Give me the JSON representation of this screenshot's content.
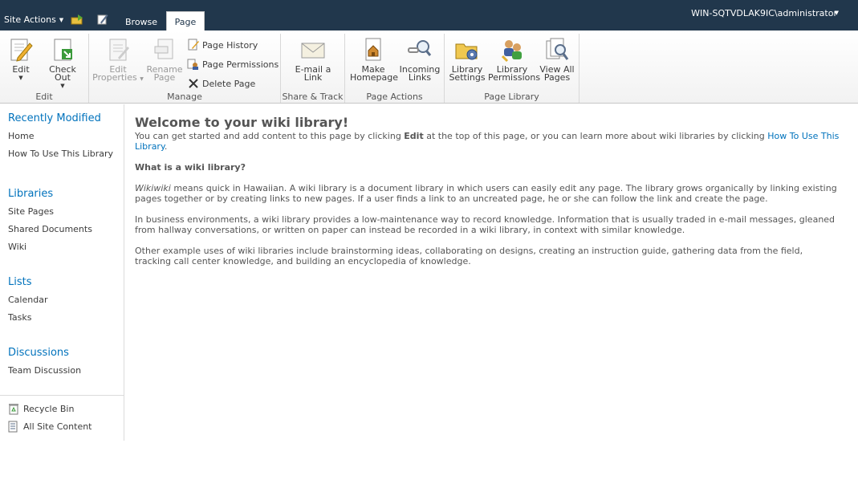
{
  "topbar": {
    "site_actions": "Site Actions",
    "tabs": [
      {
        "label": "Browse"
      },
      {
        "label": "Page"
      }
    ],
    "user": "WIN-SQTVDLAK9IC\\administrator"
  },
  "ribbon": {
    "groups": {
      "edit": {
        "label": "Edit",
        "edit_l1": "Edit",
        "checkout_l1": "Check Out"
      },
      "manage": {
        "label": "Manage",
        "props_l1": "Edit",
        "props_l2": "Properties",
        "rename_l1": "Rename",
        "rename_l2": "Page",
        "page_history": "Page History",
        "page_permissions": "Page Permissions",
        "delete_page": "Delete Page"
      },
      "share": {
        "label": "Share & Track",
        "email_l1": "E-mail a",
        "email_l2": "Link"
      },
      "page_actions": {
        "label": "Page Actions",
        "home_l1": "Make",
        "home_l2": "Homepage",
        "links_l1": "Incoming",
        "links_l2": "Links"
      },
      "library": {
        "label": "Page Library",
        "settings_l1": "Library",
        "settings_l2": "Settings",
        "perms_l1": "Library",
        "perms_l2": "Permissions",
        "viewall_l1": "View All",
        "viewall_l2": "Pages"
      }
    }
  },
  "leftnav": {
    "recently_modified": "Recently Modified",
    "recent_items": [
      "Home",
      "How To Use This Library"
    ],
    "libraries": "Libraries",
    "library_items": [
      "Site Pages",
      "Shared Documents",
      "Wiki"
    ],
    "lists": "Lists",
    "list_items": [
      "Calendar",
      "Tasks"
    ],
    "discussions": "Discussions",
    "discussion_items": [
      "Team Discussion"
    ],
    "recycle_bin": "Recycle Bin",
    "all_site_content": "All Site Content"
  },
  "content": {
    "title": "Welcome to your wiki library!",
    "intro_a": "You can get started and add content to this page by clicking ",
    "intro_bold": "Edit",
    "intro_b": " at the top of this page, or you can learn more about wiki libraries by clicking ",
    "intro_link": "How To Use This Library",
    "intro_end": ".",
    "heading": "What is a wiki library?",
    "p1_italic": "Wikiwiki",
    "p1": " means quick in Hawaiian. A wiki library is a document library in which users can easily edit any page. The library grows organically by linking existing pages together or by creating links to new pages. If a user finds a link to an uncreated page, he or she can follow the link and create the page.",
    "p2": "In business environments, a wiki library provides a low-maintenance way to record knowledge. Information that is usually traded in e-mail messages, gleaned from hallway conversations, or written on paper can instead be recorded in a wiki library, in context with similar knowledge.",
    "p3": "Other example uses of wiki libraries include brainstorming ideas, collaborating on designs, creating an instruction guide, gathering data from the field, tracking call center knowledge, and building an encyclopedia of knowledge."
  }
}
